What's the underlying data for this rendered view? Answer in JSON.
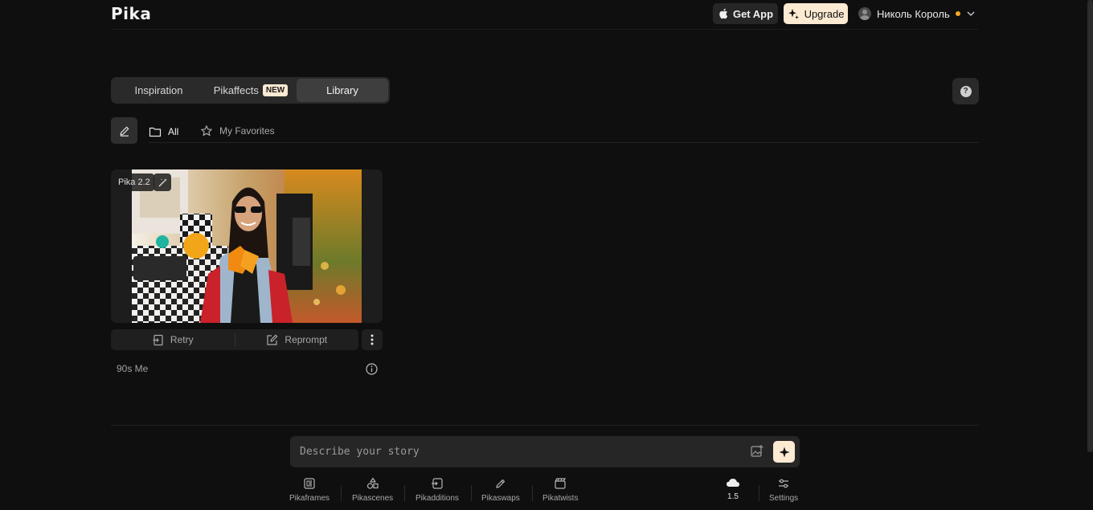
{
  "header": {
    "logo": "Pika",
    "get_app_label": "Get App",
    "upgrade_label": "Upgrade",
    "user_name": "Николь Король",
    "status_dot_color": "#f5a623"
  },
  "tabs": [
    {
      "label": "Inspiration",
      "active": false
    },
    {
      "label": "Pikaffects",
      "badge": "NEW",
      "active": false
    },
    {
      "label": "Library",
      "active": true
    }
  ],
  "help_icon": "question-circle-icon",
  "filters": {
    "all_label": "All",
    "favorites_label": "My Favorites"
  },
  "card": {
    "model_tag": "Pika 2.2",
    "title": "90s Me",
    "retry_label": "Retry",
    "reprompt_label": "Reprompt"
  },
  "prompt": {
    "placeholder": "Describe your story"
  },
  "tools": [
    {
      "label": "Pikaframes",
      "icon": "frames-icon"
    },
    {
      "label": "Pikascenes",
      "icon": "scenes-icon"
    },
    {
      "label": "Pikadditions",
      "icon": "additions-icon"
    },
    {
      "label": "Pikaswaps",
      "icon": "swaps-icon"
    },
    {
      "label": "Pikatwists",
      "icon": "twists-icon"
    }
  ],
  "model_version": "1.5",
  "settings_label": "Settings",
  "colors": {
    "background": "#0f0f0f",
    "accent": "#fcead2"
  }
}
